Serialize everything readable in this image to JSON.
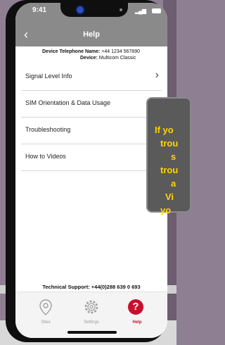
{
  "status_bar": {
    "time": "9:41",
    "signal": "▂▄▆"
  },
  "header": {
    "back_glyph": "‹",
    "title": "Help"
  },
  "device": {
    "phone_label": "Device Telephone Name:",
    "phone_value": "+44 1234 567890",
    "device_label": "Device:",
    "device_value": "Multicom Classic"
  },
  "menu": [
    {
      "label": "Signal Level Info",
      "chevron": "›"
    },
    {
      "label": "SIM Orientation & Data Usage"
    },
    {
      "label": "Troubleshooting"
    },
    {
      "label": "How to Videos"
    }
  ],
  "support_text": "Technical Support: +44(0)288 639 0 693",
  "tabs": [
    {
      "label": "Sites",
      "icon": "location-pin-icon"
    },
    {
      "label": "Settings",
      "icon": "gear-icon"
    },
    {
      "label": "Help",
      "icon": "help-icon",
      "active": true,
      "glyph": "?"
    }
  ],
  "tooltip_lines": [
    "If yo",
    "trou",
    "s",
    "trou",
    "a",
    "Vi",
    "yo"
  ],
  "colors": {
    "accent": "#c8102e",
    "tooltip_text": "#ffd400",
    "header": "#8a8a8a"
  }
}
